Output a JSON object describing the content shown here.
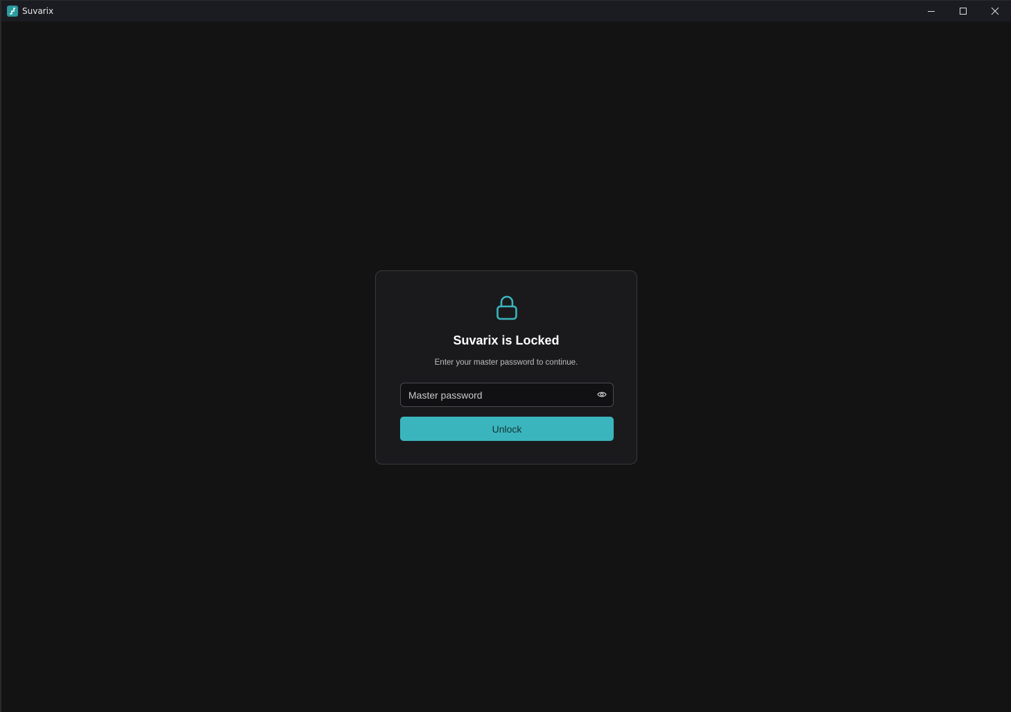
{
  "window": {
    "title": "Suvarix",
    "app_icon": "app-logo-icon",
    "controls": [
      "minimize-icon",
      "maximize-icon",
      "close-icon"
    ]
  },
  "lock_screen": {
    "icon": "lock-icon",
    "title": "Suvarix is Locked",
    "subtitle": "Enter your master password to continue.",
    "password_placeholder": "Master password",
    "password_value": "",
    "toggle_icon": "eye-icon",
    "unlock_label": "Unlock"
  },
  "colors": {
    "accent": "#3ab5bd",
    "background": "#131313",
    "card": "#1a1a1d",
    "titlebar": "#1b1c22"
  }
}
